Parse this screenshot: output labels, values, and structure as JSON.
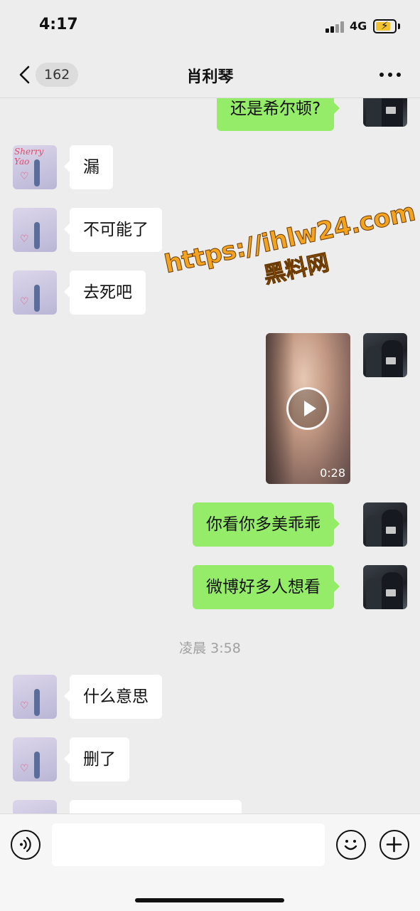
{
  "status_bar": {
    "time": "4:17",
    "network": "4G",
    "battery_icon": "battery-charging-icon",
    "signal_icon": "signal-icon"
  },
  "nav": {
    "back_icon": "chevron-left-icon",
    "unread_count": "162",
    "title": "肖利琴",
    "more_icon": "more-dots-icon"
  },
  "colors": {
    "background": "#ededed",
    "bubble_self": "#95ec69",
    "bubble_other": "#ffffff",
    "watermark": "#f4a31f"
  },
  "messages": [
    {
      "from": "self",
      "type": "text",
      "text": "还是希尔顿?"
    },
    {
      "from": "other",
      "type": "text",
      "text": "漏"
    },
    {
      "from": "other",
      "type": "text",
      "text": "不可能了"
    },
    {
      "from": "other",
      "type": "text",
      "text": "去死吧"
    },
    {
      "from": "self",
      "type": "video",
      "duration": "0:28"
    },
    {
      "from": "self",
      "type": "text",
      "text": "你看你多美乖乖"
    },
    {
      "from": "self",
      "type": "text",
      "text": "微博好多人想看"
    },
    {
      "from": "system",
      "type": "time",
      "text": "凌晨 3:58"
    },
    {
      "from": "other",
      "type": "text",
      "text": "什么意思"
    },
    {
      "from": "other",
      "type": "text",
      "text": "删了"
    },
    {
      "from": "other",
      "type": "text",
      "text": ""
    }
  ],
  "watermark": {
    "url": "https://ihlw24.com",
    "name": "黑料网"
  },
  "avatars": {
    "other_signature": "Sherry Yao"
  },
  "input_bar": {
    "voice_icon": "voice-icon",
    "input_value": "",
    "emoji_icon": "emoji-icon",
    "plus_icon": "plus-icon"
  }
}
